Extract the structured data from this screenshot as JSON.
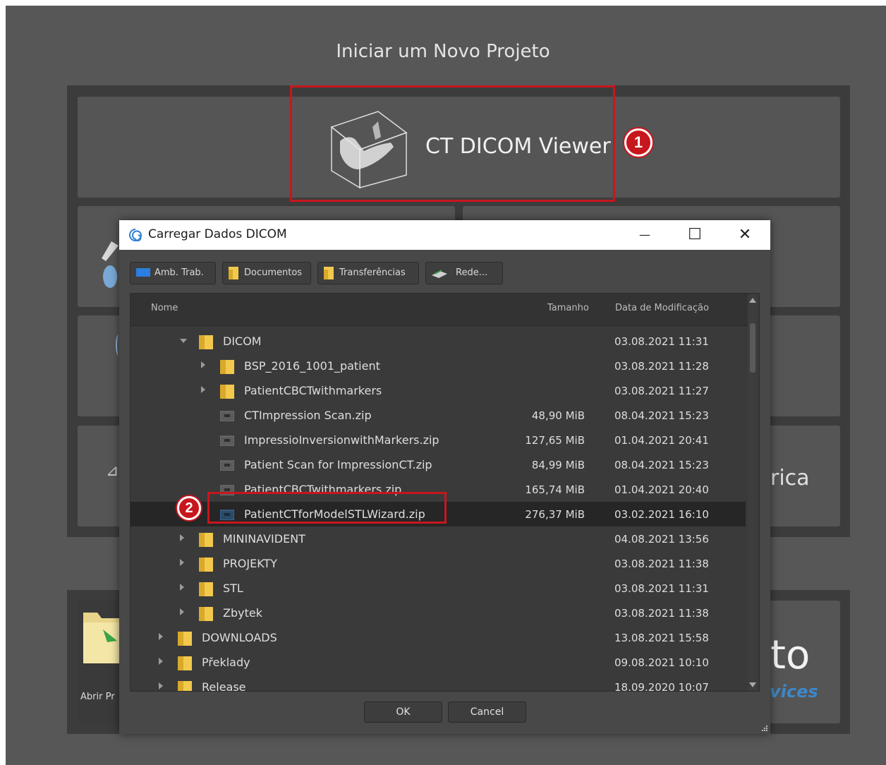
{
  "page": {
    "title": "Iniciar um Novo Projeto",
    "ct_viewer_label": "CT DICOM Viewer",
    "partial_right_label": "rica",
    "partial_logo_text": "to",
    "partial_logo_subtext": "vices",
    "abrir_label": "Abrir Pr"
  },
  "annotations": {
    "badge1": "1",
    "badge2": "2",
    "color": "#c8161d"
  },
  "dialog": {
    "title": "Carregar Dados DICOM",
    "minimize": "—",
    "maximize": "☐",
    "close": "✕",
    "quick_buttons": {
      "desktop": "Amb. Trab.",
      "documents": "Documentos",
      "downloads": "Transferências",
      "network": "Rede..."
    },
    "columns": {
      "name": "Nome",
      "size": "Tamanho",
      "modified": "Data de Modificação"
    },
    "rows": [
      {
        "name": "DICOM",
        "type": "folder",
        "size": "",
        "date": "03.08.2021 11:31"
      },
      {
        "name": "BSP_2016_1001_patient",
        "type": "folder",
        "size": "",
        "date": "03.08.2021 11:28"
      },
      {
        "name": "PatientCBCTwithmarkers",
        "type": "folder",
        "size": "",
        "date": "03.08.2021 11:27"
      },
      {
        "name": "CTImpression Scan.zip",
        "type": "file",
        "size": "48,90 MiB",
        "date": "08.04.2021 15:23"
      },
      {
        "name": "ImpressioInversionwithMarkers.zip",
        "type": "file",
        "size": "127,65 MiB",
        "date": "01.04.2021 20:41"
      },
      {
        "name": "Patient Scan for ImpressionCT.zip",
        "type": "file",
        "size": "84,99 MiB",
        "date": "08.04.2021 15:23"
      },
      {
        "name": "PatientCBCTwithmarkers.zip",
        "type": "file",
        "size": "165,74 MiB",
        "date": "01.04.2021 20:40"
      },
      {
        "name": "PatientCTforModelSTLWizard.zip",
        "type": "file",
        "size": "276,37 MiB",
        "date": "03.02.2021 16:10"
      },
      {
        "name": "MININAVIDENT",
        "type": "folder",
        "size": "",
        "date": "04.08.2021 13:56"
      },
      {
        "name": "PROJEKTY",
        "type": "folder",
        "size": "",
        "date": "03.08.2021 11:38"
      },
      {
        "name": "STL",
        "type": "folder",
        "size": "",
        "date": "03.08.2021 11:31"
      },
      {
        "name": "Zbytek",
        "type": "folder",
        "size": "",
        "date": "03.08.2021 11:38"
      },
      {
        "name": "DOWNLOADS",
        "type": "folder",
        "size": "",
        "date": "13.08.2021 15:58"
      },
      {
        "name": "Překlady",
        "type": "folder",
        "size": "",
        "date": "09.08.2021 10:10"
      },
      {
        "name": "Release",
        "type": "folder",
        "size": "",
        "date": "18.09.2020 10:07"
      }
    ],
    "ok_label": "OK",
    "cancel_label": "Cancel"
  }
}
